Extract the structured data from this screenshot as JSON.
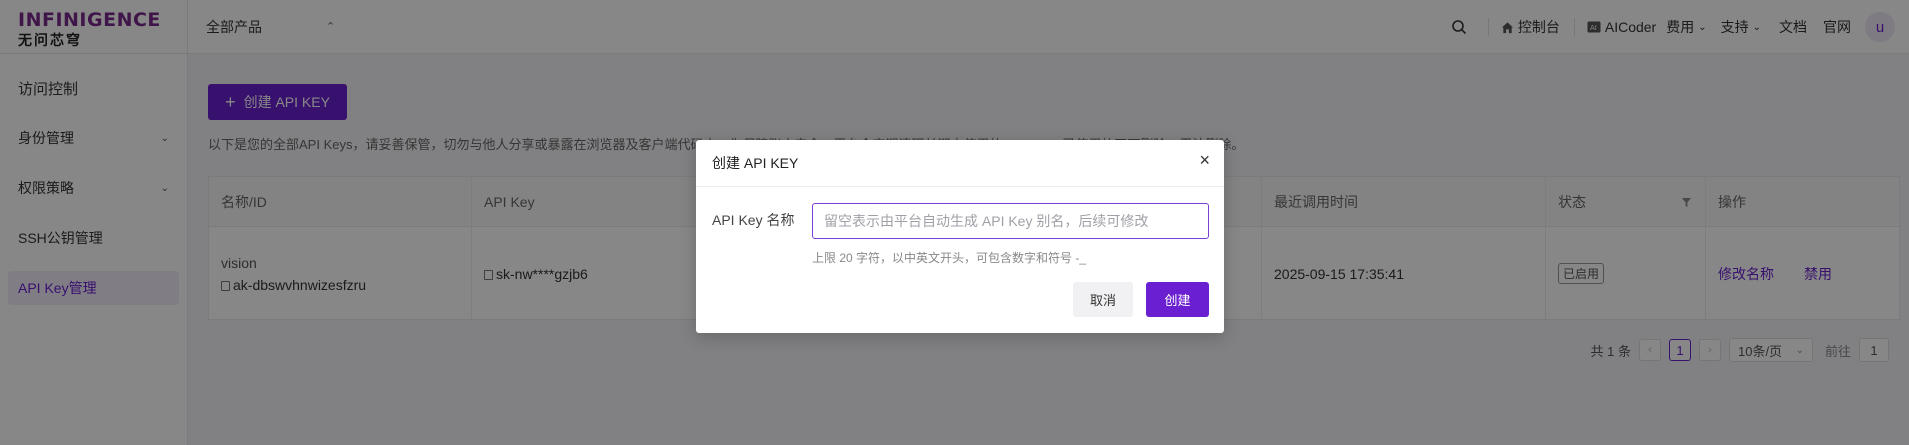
{
  "header": {
    "brand_en": "INFINIGENCE",
    "brand_cn": "无问芯穹",
    "product_switch": "全部产品",
    "console": "控制台",
    "aicoder": "AICoder",
    "billing": "费用",
    "support": "支持",
    "docs": "文档",
    "website": "官网",
    "avatar": "u"
  },
  "sidebar": {
    "items": [
      {
        "label": "访问控制"
      },
      {
        "label": "身份管理"
      },
      {
        "label": "权限策略"
      },
      {
        "label": "SSH公钥管理"
      },
      {
        "label": "API Key管理"
      }
    ]
  },
  "main": {
    "create_button": "创建 API KEY",
    "notice": "以下是您的全部API Keys，请妥善保管，切勿与他人分享或暴露在浏览器及客户端代码中。为保障账户安全，平台会定期清理长期未使用的API Key。已使用的不可删除，无法删除。",
    "table": {
      "headers": [
        "名称/ID",
        "API Key",
        "最近调用时间",
        "状态",
        "操作"
      ],
      "rows": [
        {
          "name": "vision",
          "id": "ak-dbswvhnwizesfzru",
          "api_key": "sk-nw****gzjb6",
          "last_called": "2025-09-15 17:35:41",
          "status": "已启用",
          "action_rename": "修改名称",
          "action_disable": "禁用"
        }
      ]
    },
    "pagination": {
      "total": "共 1 条",
      "current_page": "1",
      "page_size": "10条/页",
      "goto_label": "前往",
      "goto_value": "1"
    }
  },
  "modal": {
    "title": "创建 API KEY",
    "field_label": "API Key 名称",
    "field_placeholder": "留空表示由平台自动生成 API Key 别名，后续可修改",
    "field_value": "",
    "hint": "上限 20 字符，以中英文开头，可包含数字和符号 -_",
    "cancel": "取消",
    "create": "创建"
  },
  "colors": {
    "accent": "#6a1fd0",
    "overlay": "rgba(0,0,0,0.47)"
  }
}
